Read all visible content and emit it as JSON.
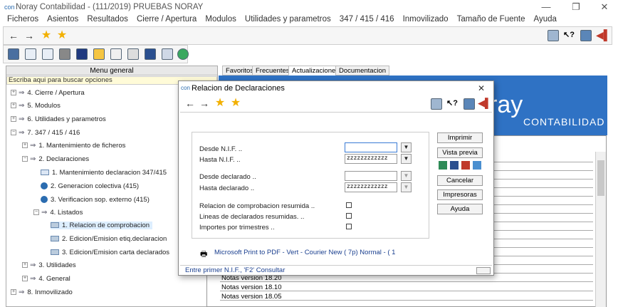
{
  "window": {
    "title": "Noray Contabilidad - (111/2019) PRUEBAS NORAY",
    "controls": [
      "—",
      "❐",
      "✕"
    ]
  },
  "menubar": [
    "Ficheros",
    "Asientos",
    "Resultados",
    "Cierre / Apertura",
    "Modulos",
    "Utilidades y parametros",
    "347 / 415 / 416",
    "Inmovilizado",
    "Tamaño de Fuente",
    "Ayuda"
  ],
  "left_panel": {
    "header": "Menu general",
    "search_placeholder": "Escriba aqui para buscar opciones",
    "tree": [
      {
        "label": "4. Cierre / Apertura"
      },
      {
        "label": "5. Modulos"
      },
      {
        "label": "6. Utilidades y parametros"
      },
      {
        "label": "7. 347 / 415 / 416"
      },
      {
        "label": "1. Mantenimiento de ficheros"
      },
      {
        "label": "2. Declaraciones"
      },
      {
        "label": "1. Mantenimiento declaracion 347/415"
      },
      {
        "label": "2. Generacion colectiva (415)"
      },
      {
        "label": "3. Verificacion sop. externo (415)"
      },
      {
        "label": "4. Listados"
      },
      {
        "label": "1. Relacion de comprobacion"
      },
      {
        "label": "2. Edicion/Emision etiq.declaracion"
      },
      {
        "label": "3. Edicion/Emision carta declarados"
      },
      {
        "label": "3. Utilidades"
      },
      {
        "label": "4. General"
      },
      {
        "label": "8. Inmovilizado"
      }
    ]
  },
  "tabs": [
    "Favoritos",
    "Frecuentes",
    "Actualizaciones",
    "Documentacion"
  ],
  "banner": {
    "brand": "ray",
    "sub": "CONTABILIDAD"
  },
  "notes": [
    "Notas version 18.20",
    "Notas version 18.10",
    "Notas version 18.05"
  ],
  "dialog": {
    "title": "Relacion de Declaraciones",
    "fields": {
      "desde_nif_label": "Desde N.I.F. ..",
      "desde_nif_value": "",
      "hasta_nif_label": "Hasta N.I.F. ..",
      "hasta_nif_value": "zzzzzzzzzzzz",
      "desde_decl_label": "Desde declarado ..",
      "desde_decl_value": "",
      "hasta_decl_label": "Hasta declarado ..",
      "hasta_decl_value": "zzzzzzzzzzzz"
    },
    "checks": [
      "Relacion de comprobacion resumida ..",
      "Lineas de declarados resumidas. ..",
      "Importes por trimestres .."
    ],
    "buttons": [
      "Imprimir",
      "Vista previa",
      "Cancelar",
      "Impresoras",
      "Ayuda"
    ],
    "printer": "Microsoft Print to PDF - Vert - Courier New ( 7p) Normal - ( 1",
    "status": "Entre primer N.I.F., 'F2' Consultar"
  }
}
